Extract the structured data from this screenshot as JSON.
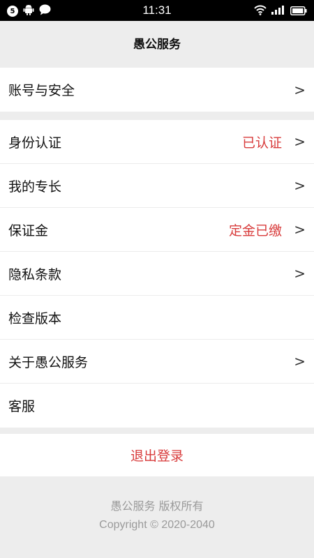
{
  "status_bar": {
    "notification_count": "5",
    "time": "11:31"
  },
  "header": {
    "title": "愚公服务"
  },
  "groups": [
    {
      "items": [
        {
          "label": "账号与安全",
          "value": "",
          "chevron": ">"
        }
      ]
    },
    {
      "items": [
        {
          "label": "身份认证",
          "value": "已认证",
          "chevron": ">"
        },
        {
          "label": "我的专长",
          "value": "",
          "chevron": ">"
        },
        {
          "label": "保证金",
          "value": "定金已缴",
          "chevron": ">"
        },
        {
          "label": "隐私条款",
          "value": "",
          "chevron": ">"
        },
        {
          "label": "检查版本",
          "value": "",
          "chevron": ""
        },
        {
          "label": "关于愚公服务",
          "value": "",
          "chevron": ">"
        },
        {
          "label": "客服",
          "value": "",
          "chevron": ""
        }
      ]
    }
  ],
  "logout": {
    "label": "退出登录"
  },
  "footer": {
    "rights": "愚公服务 版权所有",
    "copyright": "Copyright © 2020-2040"
  },
  "colors": {
    "accent_red": "#d83b3b",
    "background": "#ededed",
    "status_bar": "#000000"
  }
}
